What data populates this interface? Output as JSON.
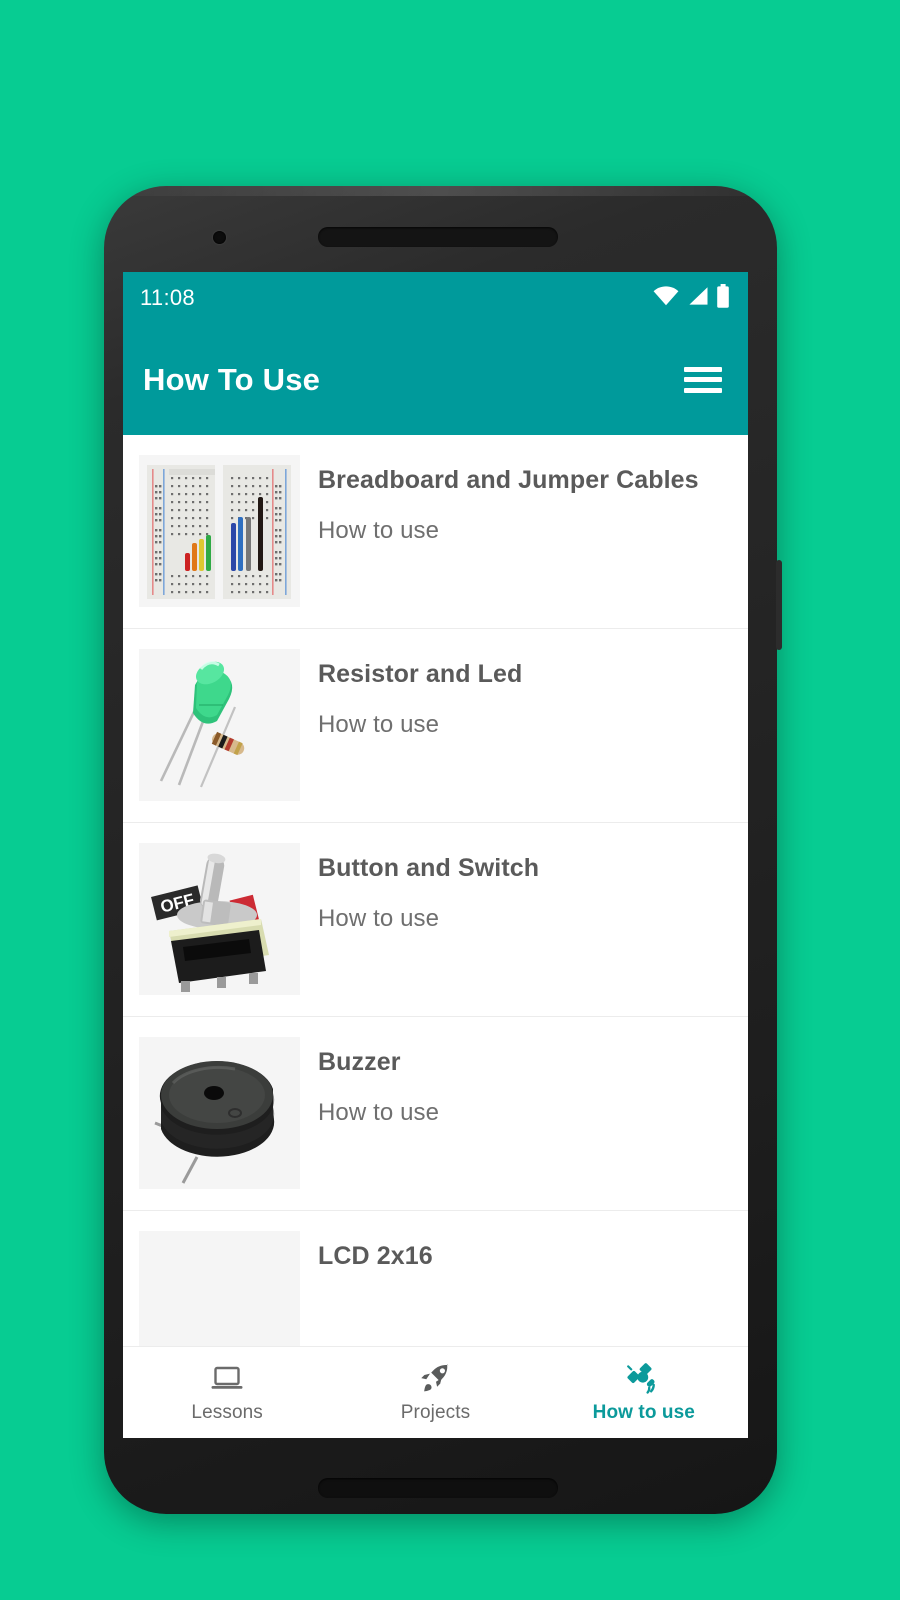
{
  "device": {
    "frame": "android-phone",
    "camera_icon": "camera-dot",
    "earpiece_icon": "speaker-grille"
  },
  "theme": {
    "background": "#07cc92",
    "accent": "#009a9b",
    "appbar_text": "#ffffff",
    "title_text": "#5a5a5a",
    "subtitle_text": "#6f6f6f",
    "nav_inactive": "#6b6b6b",
    "nav_active": "#0c9a9b",
    "divider": "#ececec",
    "thumb_bg": "#f5f5f5"
  },
  "status_bar": {
    "time": "11:08",
    "icons": [
      "wifi-icon",
      "signal-icon",
      "battery-icon"
    ]
  },
  "app_bar": {
    "title": "How To Use",
    "menu_icon": "hamburger-menu-icon"
  },
  "list": {
    "items": [
      {
        "title": "Breadboard and Jumper Cables",
        "subtitle": "How to use",
        "thumb": "breadboard-jumper-cables-image"
      },
      {
        "title": "Resistor and Led",
        "subtitle": "How to use",
        "thumb": "resistor-led-image"
      },
      {
        "title": "Button and Switch",
        "subtitle": "How to use",
        "thumb": "toggle-switch-image"
      },
      {
        "title": "Buzzer",
        "subtitle": "How to use",
        "thumb": "buzzer-image"
      },
      {
        "title": "LCD 2x16",
        "subtitle": "",
        "thumb": "lcd-image"
      }
    ]
  },
  "bottom_nav": {
    "items": [
      {
        "label": "Lessons",
        "icon": "laptop-icon",
        "active": false
      },
      {
        "label": "Projects",
        "icon": "rocket-icon",
        "active": false
      },
      {
        "label": "How to use",
        "icon": "satellite-icon",
        "active": true
      }
    ]
  }
}
